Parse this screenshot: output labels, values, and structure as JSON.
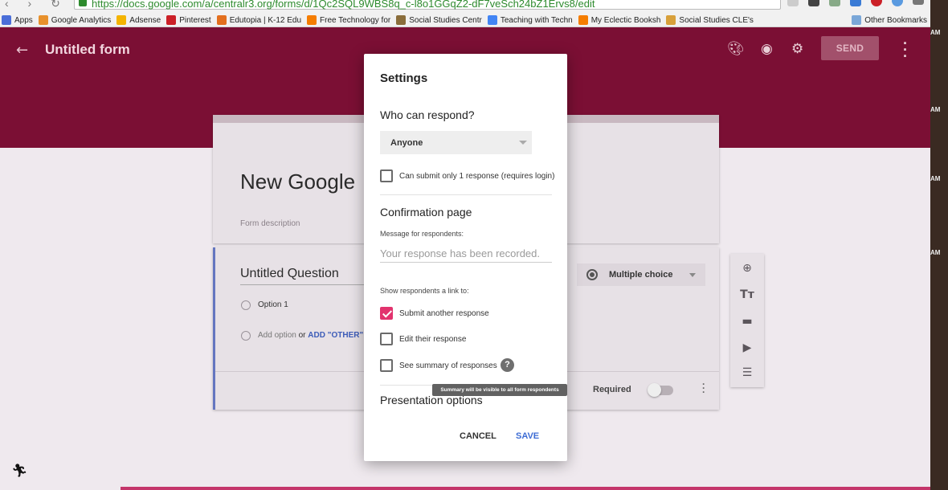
{
  "browser": {
    "url": "https://docs.google.com/a/centralr3.org/forms/d/1Qc2SQL9WBS8q_c-l8o1GGqZ2-dF7veSch24bZ1Ervs8/edit",
    "bookmarks": [
      {
        "label": "Apps",
        "color": "#4a6ed8"
      },
      {
        "label": "Google Analytics",
        "color": "#e8912c"
      },
      {
        "label": "Adsense",
        "color": "#f4b400"
      },
      {
        "label": "Pinterest",
        "color": "#cb2027"
      },
      {
        "label": "Edutopia | K-12 Edu",
        "color": "#e36f1e"
      },
      {
        "label": "Free Technology for",
        "color": "#f57d00"
      },
      {
        "label": "Social Studies Centr",
        "color": "#8a6d3b"
      },
      {
        "label": "Teaching with Techn",
        "color": "#4285f4"
      },
      {
        "label": "My Eclectic Booksh",
        "color": "#f57d00"
      },
      {
        "label": "Social Studies CLE's",
        "color": "#d8a03a"
      }
    ],
    "other_bookmarks": "Other Bookmarks"
  },
  "header": {
    "form_title": "Untitled form",
    "send_label": "SEND",
    "accent_color": "#7b0f34"
  },
  "form": {
    "heading": "New Google",
    "description_placeholder": "Form description"
  },
  "question": {
    "title": "Untitled Question",
    "option1": "Option 1",
    "add_option": "Add option",
    "or_text": "or",
    "add_other": "ADD \"OTHER\"",
    "type": "Multiple choice",
    "required_label": "Required",
    "required": false
  },
  "dialog": {
    "title": "Settings",
    "who_can_respond": "Who can respond?",
    "respondents": "Anyone",
    "submit_once_label": "Can submit only 1 response (requires login)",
    "submit_once": false,
    "confirmation_heading": "Confirmation page",
    "message_label": "Message for respondents:",
    "message_placeholder": "Your response has been recorded.",
    "link_label": "Show respondents a link to:",
    "options": [
      {
        "label": "Submit another response",
        "checked": true
      },
      {
        "label": "Edit their response",
        "checked": false
      },
      {
        "label": "See summary of responses",
        "checked": false
      }
    ],
    "help_glyph": "?",
    "tooltip": "Summary will be visible to all form respondents",
    "presentation_heading": "Presentation options",
    "cancel_label": "CANCEL",
    "save_label": "SAVE"
  },
  "side_clock": [
    "AM",
    "AM",
    "AM",
    "AM"
  ]
}
